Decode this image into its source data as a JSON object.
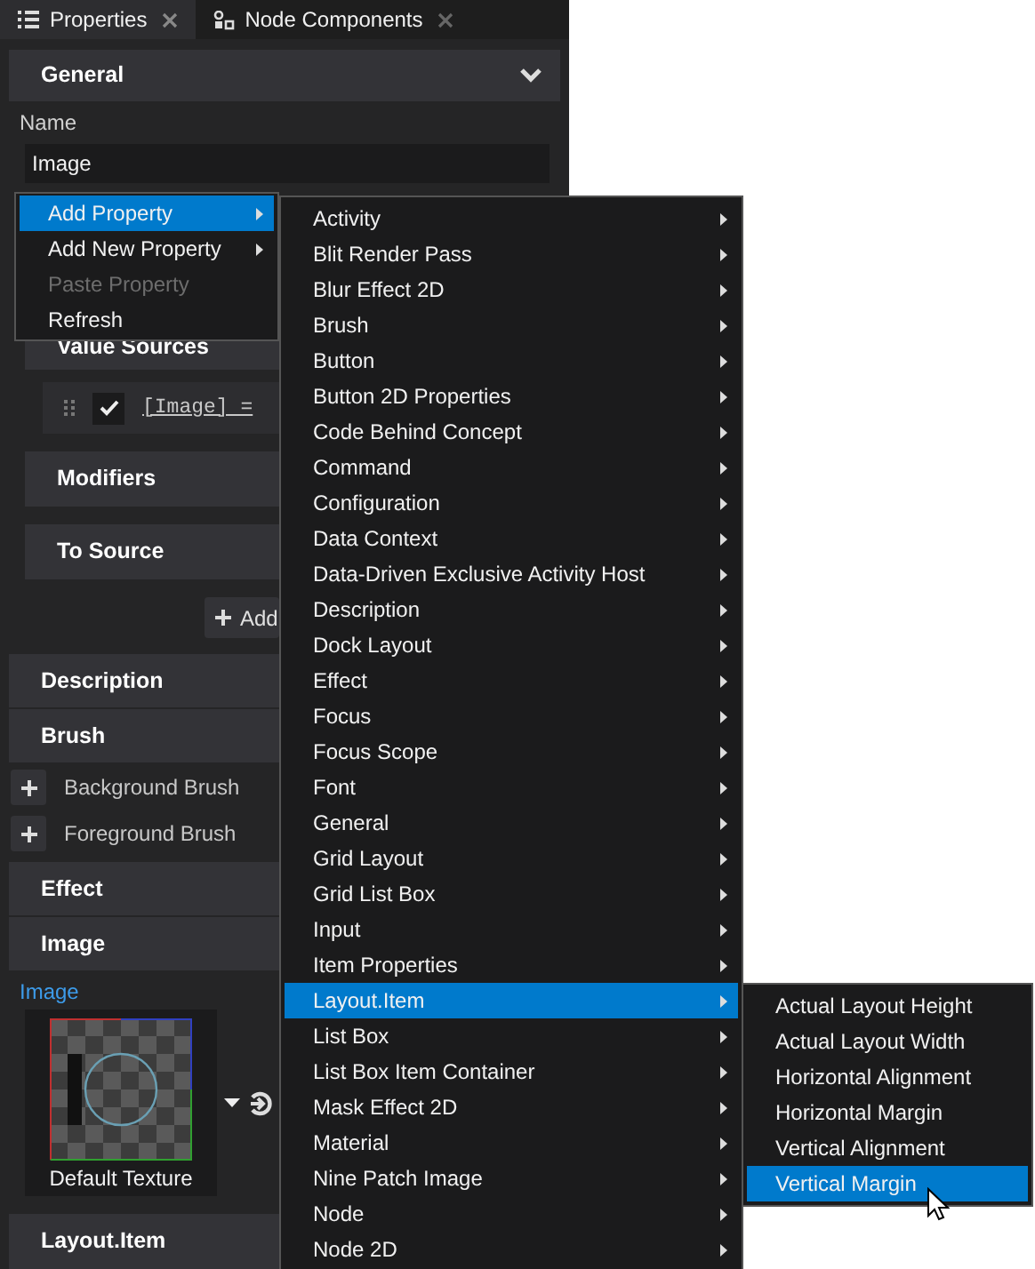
{
  "tabs": [
    {
      "label": "Properties",
      "selected": true,
      "kind": "properties"
    },
    {
      "label": "Node Components",
      "selected": false,
      "kind": "components"
    }
  ],
  "general": {
    "title": "General",
    "name_label": "Name",
    "name_value": "Image"
  },
  "binding": {
    "value_sources": "Value Sources",
    "checked": true,
    "expression": "[Image] =",
    "modifiers": "Modifiers",
    "to_source": "To Source",
    "add_button": "Add"
  },
  "description": "Description",
  "brush": {
    "title": "Brush",
    "items": [
      "Background Brush",
      "Foreground Brush"
    ]
  },
  "effect": "Effect",
  "image": {
    "title": "Image",
    "property_label": "Image",
    "texture": "Default Texture"
  },
  "layout_item": "Layout.Item",
  "context_menu": [
    {
      "label": "Add Property",
      "selected": true,
      "disabled": false,
      "submenu": true
    },
    {
      "label": "Add New Property",
      "selected": false,
      "disabled": false,
      "submenu": true
    },
    {
      "label": "Paste Property",
      "selected": false,
      "disabled": true,
      "submenu": false
    },
    {
      "label": "Refresh",
      "selected": false,
      "disabled": false,
      "submenu": false
    }
  ],
  "property_menu": [
    {
      "label": "Activity",
      "selected": false
    },
    {
      "label": "Blit Render Pass",
      "selected": false
    },
    {
      "label": "Blur Effect 2D",
      "selected": false
    },
    {
      "label": "Brush",
      "selected": false
    },
    {
      "label": "Button",
      "selected": false
    },
    {
      "label": "Button 2D Properties",
      "selected": false
    },
    {
      "label": "Code Behind Concept",
      "selected": false
    },
    {
      "label": "Command",
      "selected": false
    },
    {
      "label": "Configuration",
      "selected": false
    },
    {
      "label": "Data Context",
      "selected": false
    },
    {
      "label": "Data-Driven Exclusive Activity Host",
      "selected": false
    },
    {
      "label": "Description",
      "selected": false
    },
    {
      "label": "Dock Layout",
      "selected": false
    },
    {
      "label": "Effect",
      "selected": false
    },
    {
      "label": "Focus",
      "selected": false
    },
    {
      "label": "Focus Scope",
      "selected": false
    },
    {
      "label": "Font",
      "selected": false
    },
    {
      "label": "General",
      "selected": false
    },
    {
      "label": "Grid Layout",
      "selected": false
    },
    {
      "label": "Grid List Box",
      "selected": false
    },
    {
      "label": "Input",
      "selected": false
    },
    {
      "label": "Item Properties",
      "selected": false
    },
    {
      "label": "Layout.Item",
      "selected": true
    },
    {
      "label": "List Box",
      "selected": false
    },
    {
      "label": "List Box Item Container",
      "selected": false
    },
    {
      "label": "Mask Effect 2D",
      "selected": false
    },
    {
      "label": "Material",
      "selected": false
    },
    {
      "label": "Nine Patch Image",
      "selected": false
    },
    {
      "label": "Node",
      "selected": false
    },
    {
      "label": "Node 2D",
      "selected": false
    }
  ],
  "layout_item_menu": [
    {
      "label": "Actual Layout Height",
      "selected": false
    },
    {
      "label": "Actual Layout Width",
      "selected": false
    },
    {
      "label": "Horizontal Alignment",
      "selected": false
    },
    {
      "label": "Horizontal Margin",
      "selected": false
    },
    {
      "label": "Vertical Alignment",
      "selected": false
    },
    {
      "label": "Vertical Margin",
      "selected": true
    }
  ]
}
